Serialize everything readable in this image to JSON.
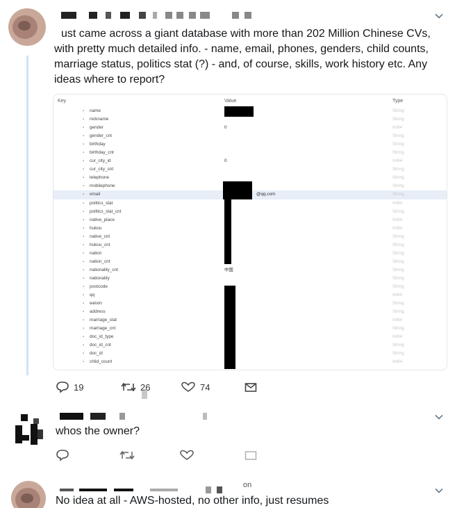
{
  "tweets": [
    {
      "text_lines": [
        "ust came across a giant database with more than 202 Million Chinese CVs,",
        "with pretty much detailed info. - name, email, phones, genders, child counts,",
        "marriage status, politics stat (?) - and, of course, skills, work history etc. Any",
        "ideas where to report?"
      ],
      "actions": {
        "reply": "19",
        "retweet": "26",
        "like": "74"
      }
    },
    {
      "text": "whos the owner?"
    },
    {
      "text": "No idea at all - AWS-hosted, no other info, just resumes",
      "partial_handle": "on"
    }
  ],
  "db": {
    "headers": {
      "key": "Key",
      "value": "Value",
      "type": "Type"
    },
    "rows": [
      {
        "key": "name",
        "value": "",
        "type": "String"
      },
      {
        "key": "nickname",
        "value": "",
        "type": "String"
      },
      {
        "key": "gender",
        "value": "0",
        "type": "Int64"
      },
      {
        "key": "gender_cnt",
        "value": "",
        "type": "String"
      },
      {
        "key": "birthday",
        "value": "",
        "type": "String"
      },
      {
        "key": "birthday_cnt",
        "value": "",
        "type": "String"
      },
      {
        "key": "cur_city_id",
        "value": "0",
        "type": "Int64"
      },
      {
        "key": "cur_city_cnt",
        "value": "",
        "type": "String"
      },
      {
        "key": "telephone",
        "value": "",
        "type": "String"
      },
      {
        "key": "mobilephone",
        "value": "",
        "type": "String"
      },
      {
        "key": "email",
        "value": "@qq.com",
        "type": "String"
      },
      {
        "key": "politics_stat",
        "value": "",
        "type": "Int64"
      },
      {
        "key": "politics_stat_cnt",
        "value": "",
        "type": "String"
      },
      {
        "key": "native_place",
        "value": "",
        "type": "Int64"
      },
      {
        "key": "hukou",
        "value": "",
        "type": "Int64"
      },
      {
        "key": "native_cnt",
        "value": "",
        "type": "String"
      },
      {
        "key": "hukou_cnt",
        "value": "",
        "type": "String"
      },
      {
        "key": "nation",
        "value": "",
        "type": "String"
      },
      {
        "key": "nation_cnt",
        "value": "",
        "type": "String"
      },
      {
        "key": "nationality_cnt",
        "value": "中国",
        "type": "String"
      },
      {
        "key": "nationality",
        "value": "",
        "type": "String"
      },
      {
        "key": "postcode",
        "value": "",
        "type": "String"
      },
      {
        "key": "qq",
        "value": "",
        "type": "Int64"
      },
      {
        "key": "weixin",
        "value": "",
        "type": "String"
      },
      {
        "key": "address",
        "value": "",
        "type": "String"
      },
      {
        "key": "marriage_stat",
        "value": "",
        "type": "Int64"
      },
      {
        "key": "marriage_cnt",
        "value": "",
        "type": "String"
      },
      {
        "key": "doc_id_type",
        "value": "",
        "type": "Int64"
      },
      {
        "key": "doc_id_cnt",
        "value": "",
        "type": "String"
      },
      {
        "key": "doc_id",
        "value": "",
        "type": "String"
      },
      {
        "key": "child_count",
        "value": "",
        "type": "Int64"
      }
    ]
  },
  "icons": {
    "reply": "reply-icon",
    "retweet": "retweet-icon",
    "like": "heart-icon",
    "dm": "envelope-icon",
    "chevron": "chevron-down-icon"
  }
}
